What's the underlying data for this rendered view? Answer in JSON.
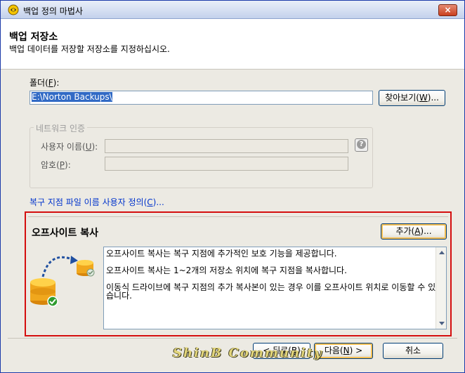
{
  "window": {
    "title": "백업 정의 마법사",
    "close_label": "×"
  },
  "header": {
    "title": "백업 저장소",
    "subtitle": "백업 데이터를 저장할 저장소를 지정하십시오."
  },
  "folder": {
    "label_prefix": "폴더(",
    "label_key": "F",
    "label_suffix": "):",
    "value": "E:\\Norton Backups\\",
    "browse_prefix": "찾아보기(",
    "browse_key": "W",
    "browse_suffix": ")..."
  },
  "network_auth": {
    "legend": "네트워크 인증",
    "username_prefix": "사용자 이름(",
    "username_key": "U",
    "username_suffix": "):",
    "username_value": "",
    "password_prefix": "암호(",
    "password_key": "P",
    "password_suffix": "):",
    "password_value": "",
    "help_icon": "help-icon",
    "help_glyph": "?"
  },
  "custom_name_link": {
    "prefix": "복구 지점 파일 이름 사용자 정의(",
    "key": "C",
    "suffix": ")..."
  },
  "offsite": {
    "title": "오프사이트 복사",
    "add_prefix": "추가(",
    "add_key": "A",
    "add_suffix": ")...",
    "lines": [
      "오프사이트 복사는 복구 지점에 추가적인 보호 기능을 제공합니다.",
      "오프사이트 복사는 1~2개의 저장소 위치에 복구 지점을 복사합니다.",
      "이동식 드라이브에 복구 지점의 추가 복사본이 있는 경우 이를 오프사이트 위치로 이동할 수 있습니다."
    ]
  },
  "footer": {
    "back_prefix": "< 뒤로(",
    "back_key": "B",
    "back_suffix": ")",
    "next_prefix": "다음(",
    "next_key": "N",
    "next_suffix": ") >",
    "cancel": "취소",
    "watermark": "ShinB Community"
  },
  "colors": {
    "highlight_border": "#d40e0e",
    "link": "#0033cc",
    "selection": "#316ac5"
  }
}
